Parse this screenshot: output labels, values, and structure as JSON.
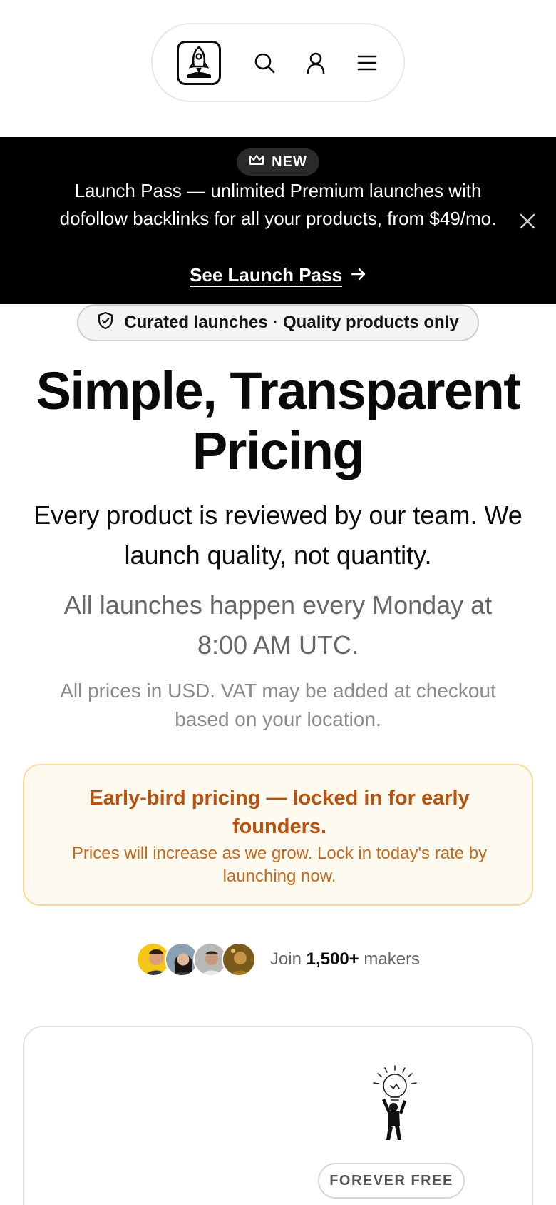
{
  "nav": {
    "logo_icon": "rocket-icon",
    "icons": [
      "search-icon",
      "user-icon",
      "menu-icon"
    ]
  },
  "banner": {
    "badge": "NEW",
    "text": "Launch Pass — unlimited Premium launches with dofollow backlinks for all your products, from $49/mo.",
    "link": "See Launch Pass",
    "colors": {
      "background": "#000000",
      "text": "#ffffff"
    }
  },
  "curated": {
    "label": "Curated launches · Quality products only"
  },
  "hero": {
    "title": "Simple, Transparent Pricing",
    "subtitle": "Every product is reviewed by our team. We launch quality, not quantity.",
    "schedule": "All launches happen every Monday at 8:00 AM UTC.",
    "vat_note": "All prices in USD. VAT may be added at checkout based on your location."
  },
  "earlybird": {
    "title": "Early-bird pricing — locked in for early founders.",
    "text": "Prices will increase as we grow. Lock in today's rate by launching now.",
    "colors": {
      "accent": "#b4530f",
      "background": "#fffaf0",
      "border": "#fbd99b"
    }
  },
  "makers": {
    "prefix": "Join",
    "count": "1,500+",
    "suffix": "makers"
  },
  "plan_card": {
    "badge": "FOREVER FREE"
  }
}
